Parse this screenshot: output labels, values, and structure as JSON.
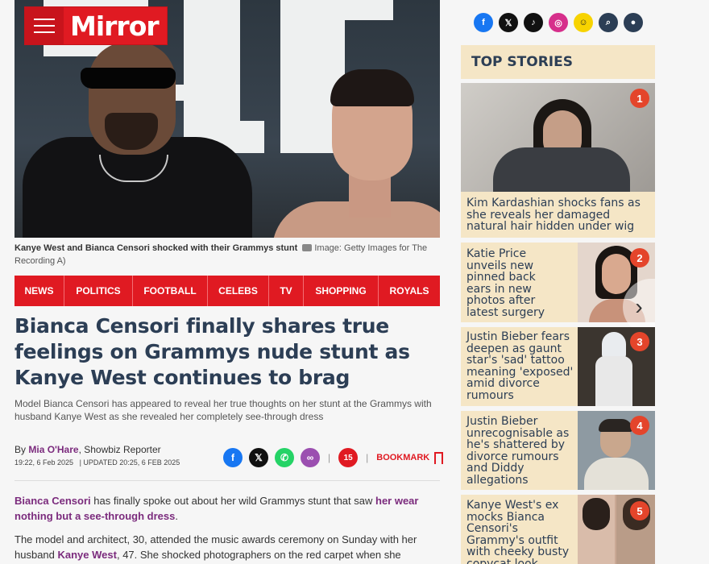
{
  "masthead": {
    "logo": "Mirror"
  },
  "caption": {
    "text": "Kanye West and Bianca Censori shocked with their Grammys stunt",
    "credit": "Image: Getty Images for The Recording A)"
  },
  "nav": {
    "items": [
      "NEWS",
      "POLITICS",
      "FOOTBALL",
      "CELEBS",
      "TV",
      "SHOPPING",
      "ROYALS"
    ]
  },
  "article": {
    "headline": "Bianca Censori finally shares true feelings on Grammys nude stunt as Kanye West continues to brag",
    "standfirst": "Model Bianca Censori has appeared to reveal her true thoughts on her stunt at the Grammys with husband Kanye West as she revealed her completely see-through dress",
    "byline_prefix": "By",
    "author": "Mia O'Hare",
    "role": ", Showbiz Reporter",
    "published": "19:22, 6 Feb 2025",
    "updated": "| UPDATED 20:25, 6 FEB 2025",
    "comments_count": "15",
    "bookmark_label": "BOOKMARK",
    "p1_link1": "Bianca Censori",
    "p1_text": " has finally spoke out about her wild Grammys stunt that saw ",
    "p1_link2": "her wear nothing but a see-through dress",
    "p1_end": ".",
    "p2_text1": "The model and architect, 30, attended the music awards ceremony on Sunday with her husband ",
    "p2_link": "Kanye West",
    "p2_text2": ", 47. She shocked photographers on the red carpet when she"
  },
  "top_stories": {
    "heading": "TOP STORIES",
    "items": [
      {
        "rank": "1",
        "title": "Kim Kardashian shocks fans as she reveals her damaged natural hair hidden under wig"
      },
      {
        "rank": "2",
        "title": "Katie Price unveils new pinned back ears in new photos after latest surgery"
      },
      {
        "rank": "3",
        "title": "Justin Bieber fears deepen as gaunt star's 'sad' tattoo meaning 'exposed' amid divorce rumours"
      },
      {
        "rank": "4",
        "title": "Justin Bieber unrecognisable as he's shattered by divorce rumours and Diddy allegations"
      },
      {
        "rank": "5",
        "title": "Kanye West's ex mocks Bianca Censori's Grammy's outfit with cheeky busty copycat look"
      }
    ]
  },
  "icons": {
    "share": [
      "facebook-icon",
      "x-icon",
      "whatsapp-icon",
      "link-icon"
    ],
    "social": [
      "facebook-icon",
      "x-icon",
      "tiktok-icon",
      "instagram-icon",
      "snapchat-icon",
      "search-icon",
      "account-icon"
    ]
  },
  "colors": {
    "brand_red": "#e01a22",
    "navy": "#2c3e55",
    "link_purple": "#7b2b7d",
    "story_bg": "#f5e6c6",
    "rank_orange": "#e4452b"
  }
}
